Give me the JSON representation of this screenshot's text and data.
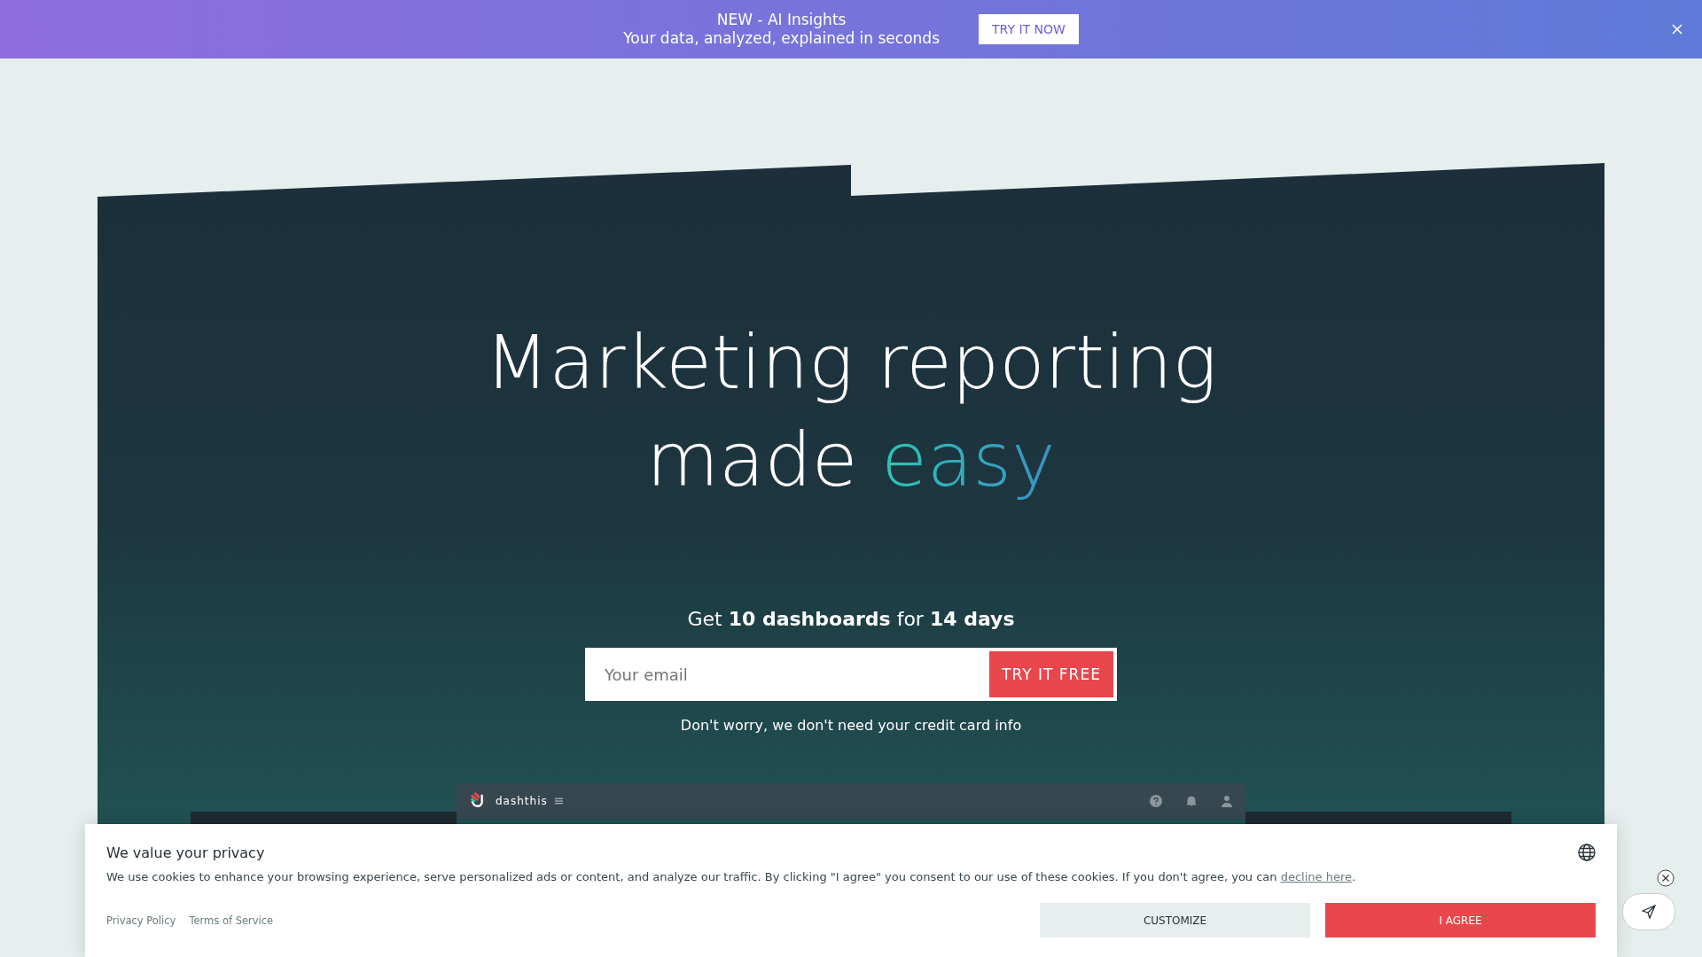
{
  "announcement": {
    "title": "NEW - AI Insights",
    "subtitle": "Your data, analyzed, explained in seconds",
    "button": "TRY IT NOW"
  },
  "hero": {
    "title": "Marketing reporting made",
    "title_highlight": "easy",
    "offer": "Get **10 dashboards** for **14 days**",
    "email_placeholder": "Your email",
    "button": "TRY IT FREE",
    "note": "Don't worry, we don't need your credit card info"
  },
  "preview": {
    "brand": "dashthis"
  },
  "cookie_banner": {
    "title": "We value your privacy",
    "text": "We use cookies to enhance your browsing experience, serve personalized ads or content, and analyze our traffic. By clicking \"I agree\" you consent to our use of these cookies. If you don't agree, you can",
    "link": "decline here",
    "link_suffix": ".",
    "links": [
      "Privacy Policy",
      "Terms of Service"
    ],
    "buttons": [
      {
        "label": "CUSTOMIZE",
        "kind": "secondary"
      },
      {
        "label": "I AGREE",
        "kind": "primary"
      }
    ]
  }
}
